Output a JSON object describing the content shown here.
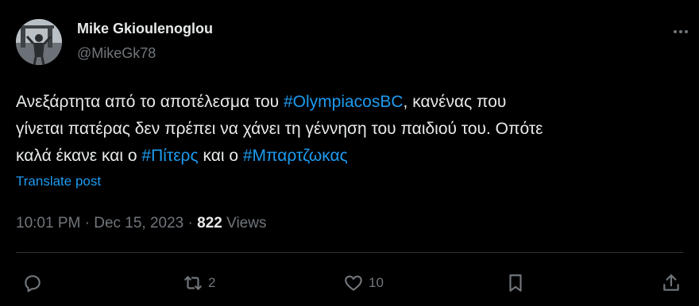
{
  "author": {
    "display_name": "Mike Gkioulenoglou",
    "handle": "@MikeGk78"
  },
  "tweet": {
    "lines": [
      [
        {
          "text": "Ανεξάρτητα από το αποτέλεσμα του ",
          "hashtag": false
        },
        {
          "text": "#OlympiacosBC",
          "hashtag": true
        },
        {
          "text": ", κανένας που",
          "hashtag": false
        }
      ],
      [
        {
          "text": "γίνεται πατέρας δεν πρέπει να χάνει τη γέννηση του παιδιού του. Οπότε",
          "hashtag": false
        }
      ],
      [
        {
          "text": "καλά έκανε και ο ",
          "hashtag": false
        },
        {
          "text": "#Πίτερς",
          "hashtag": true
        },
        {
          "text": " και ο ",
          "hashtag": false
        },
        {
          "text": "#Μπαρτζωκας",
          "hashtag": true
        }
      ]
    ],
    "translate_label": "Translate post",
    "time": "10:01 PM",
    "date": "Dec 15, 2023",
    "separator": "·",
    "views_count": "822",
    "views_label": "Views"
  },
  "actions": {
    "replies": "",
    "reposts": "2",
    "likes": "10"
  },
  "colors": {
    "background": "#000000",
    "text": "#e7e9ea",
    "muted": "#71767b",
    "accent": "#1d9bf0",
    "divider": "#2f3336"
  },
  "icons": [
    "avatar",
    "more-icon",
    "reply-icon",
    "repost-icon",
    "like-icon",
    "bookmark-icon",
    "share-icon"
  ]
}
